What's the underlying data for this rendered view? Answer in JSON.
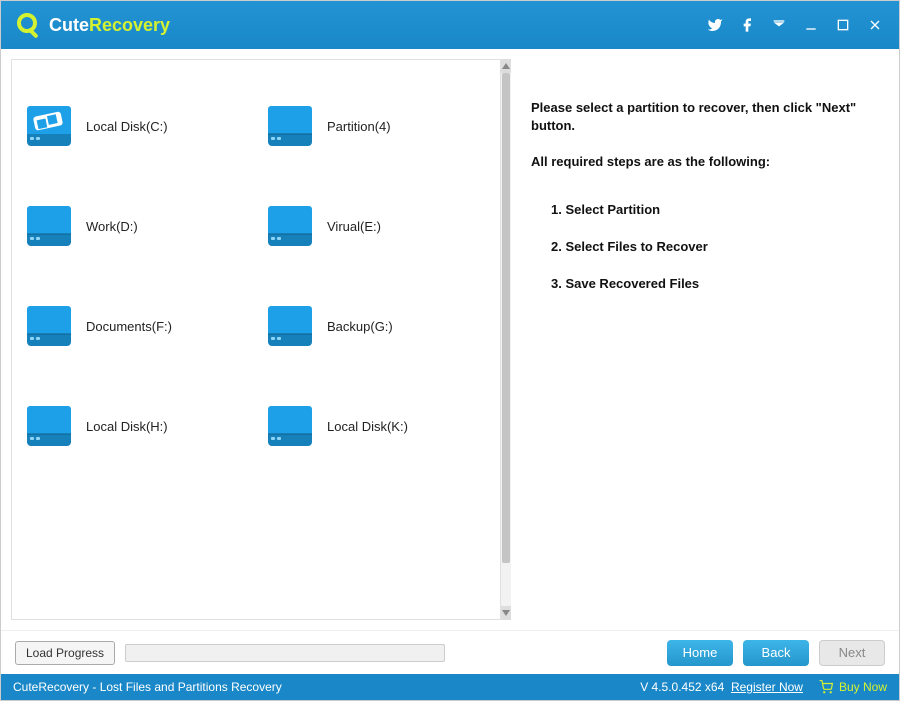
{
  "app": {
    "title_cute": "Cute",
    "title_recovery": "Recovery"
  },
  "partitions": [
    {
      "label": "Local Disk(C:)",
      "type": "system"
    },
    {
      "label": "Partition(4)",
      "type": "data"
    },
    {
      "label": "Work(D:)",
      "type": "data"
    },
    {
      "label": "Virual(E:)",
      "type": "data"
    },
    {
      "label": "Documents(F:)",
      "type": "data"
    },
    {
      "label": "Backup(G:)",
      "type": "data"
    },
    {
      "label": "Local Disk(H:)",
      "type": "data"
    },
    {
      "label": "Local Disk(K:)",
      "type": "data"
    }
  ],
  "instructions": {
    "line1": "Please select a partition to recover, then click \"Next\" button.",
    "line2": "All required steps are as the following:",
    "steps": [
      "1. Select Partition",
      "2. Select Files to Recover",
      "3. Save Recovered Files"
    ]
  },
  "buttons": {
    "load_progress": "Load Progress",
    "home": "Home",
    "back": "Back",
    "next": "Next"
  },
  "statusbar": {
    "left": "CuteRecovery - Lost Files and Partitions Recovery",
    "version": "V 4.5.0.452 x64",
    "register": "Register Now",
    "buy": "Buy Now"
  }
}
